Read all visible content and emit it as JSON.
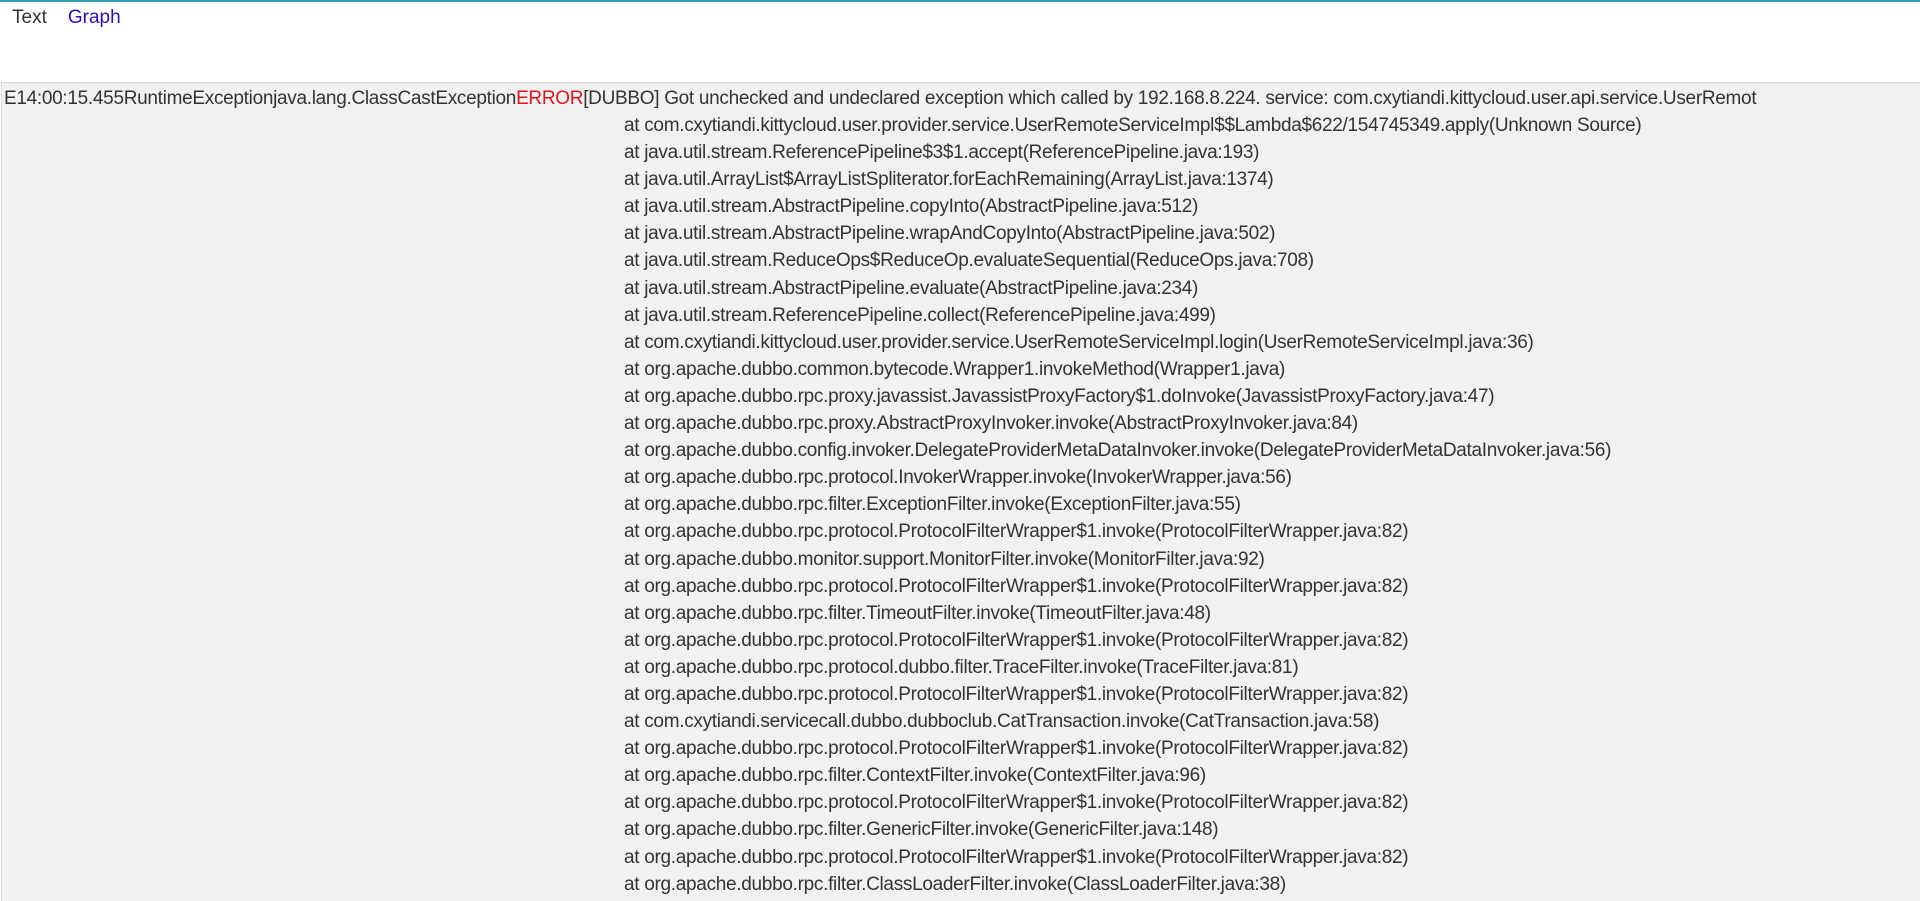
{
  "tabs": [
    {
      "label": "Text"
    },
    {
      "label": "Graph"
    }
  ],
  "colors": {
    "accent_rule": "#2ea3b8",
    "link": "#2a12b8",
    "error_level": "#e3141b",
    "panel_bg": "#f1f1f1",
    "text": "#333333"
  },
  "log": {
    "type": "E",
    "time": "14:00:15.455",
    "name": "RuntimeException",
    "exception_class": "java.lang.ClassCastException",
    "level": "ERROR",
    "message": "[DUBBO] Got unchecked and undeclared exception which called by 192.168.8.224. service: com.cxytiandi.kittycloud.user.api.service.UserRemot",
    "frames": [
      "at com.cxytiandi.kittycloud.user.provider.service.UserRemoteServiceImpl$$Lambda$622/154745349.apply(Unknown Source)",
      "at java.util.stream.ReferencePipeline$3$1.accept(ReferencePipeline.java:193)",
      "at java.util.ArrayList$ArrayListSpliterator.forEachRemaining(ArrayList.java:1374)",
      "at java.util.stream.AbstractPipeline.copyInto(AbstractPipeline.java:512)",
      "at java.util.stream.AbstractPipeline.wrapAndCopyInto(AbstractPipeline.java:502)",
      "at java.util.stream.ReduceOps$ReduceOp.evaluateSequential(ReduceOps.java:708)",
      "at java.util.stream.AbstractPipeline.evaluate(AbstractPipeline.java:234)",
      "at java.util.stream.ReferencePipeline.collect(ReferencePipeline.java:499)",
      "at com.cxytiandi.kittycloud.user.provider.service.UserRemoteServiceImpl.login(UserRemoteServiceImpl.java:36)",
      "at org.apache.dubbo.common.bytecode.Wrapper1.invokeMethod(Wrapper1.java)",
      "at org.apache.dubbo.rpc.proxy.javassist.JavassistProxyFactory$1.doInvoke(JavassistProxyFactory.java:47)",
      "at org.apache.dubbo.rpc.proxy.AbstractProxyInvoker.invoke(AbstractProxyInvoker.java:84)",
      "at org.apache.dubbo.config.invoker.DelegateProviderMetaDataInvoker.invoke(DelegateProviderMetaDataInvoker.java:56)",
      "at org.apache.dubbo.rpc.protocol.InvokerWrapper.invoke(InvokerWrapper.java:56)",
      "at org.apache.dubbo.rpc.filter.ExceptionFilter.invoke(ExceptionFilter.java:55)",
      "at org.apache.dubbo.rpc.protocol.ProtocolFilterWrapper$1.invoke(ProtocolFilterWrapper.java:82)",
      "at org.apache.dubbo.monitor.support.MonitorFilter.invoke(MonitorFilter.java:92)",
      "at org.apache.dubbo.rpc.protocol.ProtocolFilterWrapper$1.invoke(ProtocolFilterWrapper.java:82)",
      "at org.apache.dubbo.rpc.filter.TimeoutFilter.invoke(TimeoutFilter.java:48)",
      "at org.apache.dubbo.rpc.protocol.ProtocolFilterWrapper$1.invoke(ProtocolFilterWrapper.java:82)",
      "at org.apache.dubbo.rpc.protocol.dubbo.filter.TraceFilter.invoke(TraceFilter.java:81)",
      "at org.apache.dubbo.rpc.protocol.ProtocolFilterWrapper$1.invoke(ProtocolFilterWrapper.java:82)",
      "at com.cxytiandi.servicecall.dubbo.dubboclub.CatTransaction.invoke(CatTransaction.java:58)",
      "at org.apache.dubbo.rpc.protocol.ProtocolFilterWrapper$1.invoke(ProtocolFilterWrapper.java:82)",
      "at org.apache.dubbo.rpc.filter.ContextFilter.invoke(ContextFilter.java:96)",
      "at org.apache.dubbo.rpc.protocol.ProtocolFilterWrapper$1.invoke(ProtocolFilterWrapper.java:82)",
      "at org.apache.dubbo.rpc.filter.GenericFilter.invoke(GenericFilter.java:148)",
      "at org.apache.dubbo.rpc.protocol.ProtocolFilterWrapper$1.invoke(ProtocolFilterWrapper.java:82)",
      "at org.apache.dubbo.rpc.filter.ClassLoaderFilter.invoke(ClassLoaderFilter.java:38)"
    ]
  }
}
